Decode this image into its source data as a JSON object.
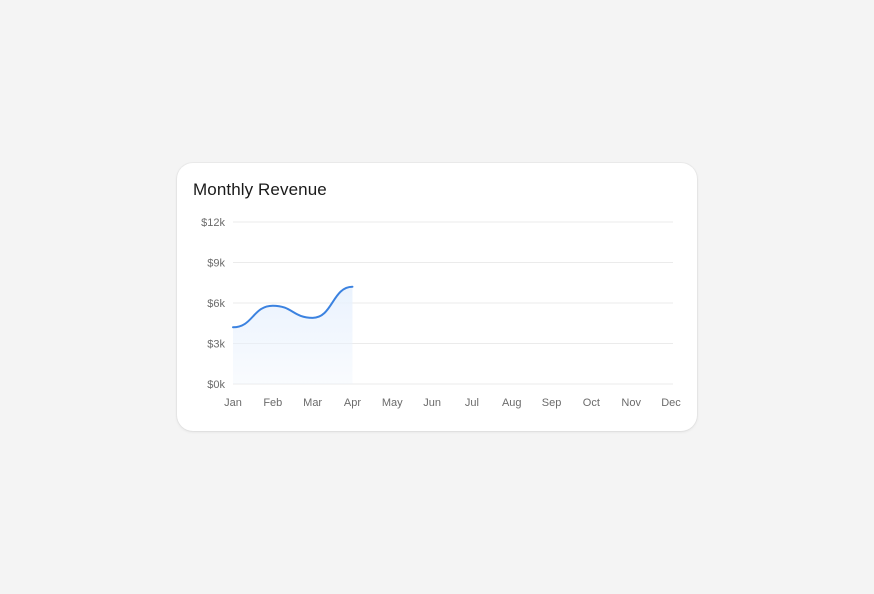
{
  "card": {
    "title": "Monthly Revenue"
  },
  "chart_data": {
    "type": "area",
    "title": "Monthly Revenue",
    "xlabel": "",
    "ylabel": "",
    "categories": [
      "Jan",
      "Feb",
      "Mar",
      "Apr",
      "May",
      "Jun",
      "Jul",
      "Aug",
      "Sep",
      "Oct",
      "Nov",
      "Dec"
    ],
    "values": [
      4200,
      5800,
      4900,
      7200,
      null,
      null,
      null,
      null,
      null,
      null,
      null,
      null
    ],
    "ylim": [
      0,
      12000
    ],
    "yticks": [
      0,
      3000,
      6000,
      9000,
      12000
    ],
    "ytick_labels": [
      "$0k",
      "$3k",
      "$6k",
      "$9k",
      "$12k"
    ],
    "grid": true,
    "legend": "none",
    "line_color": "#3b82e0",
    "fill_color": "#e8f1fd"
  }
}
